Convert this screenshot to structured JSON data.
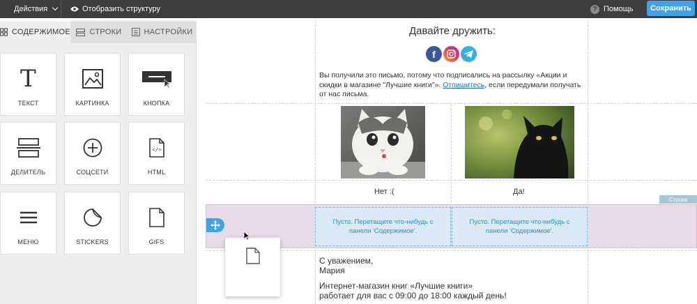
{
  "topbar": {
    "actions_label": "Действия",
    "structure_label": "Отобразить структуру",
    "help_label": "Помощь",
    "save_label": "Сохранить"
  },
  "sidebar": {
    "tabs": [
      {
        "label": "СОДЕРЖИМОЕ",
        "icon": "grid-icon",
        "active": true
      },
      {
        "label": "СТРОКИ",
        "icon": "rows-icon",
        "active": false
      },
      {
        "label": "НАСТРОЙКИ",
        "icon": "settings-panel-icon",
        "active": false
      }
    ],
    "blocks": [
      {
        "label": "ТЕКСТ",
        "icon": "text-icon"
      },
      {
        "label": "КАРТИНКА",
        "icon": "image-icon"
      },
      {
        "label": "КНОПКА",
        "icon": "button-icon"
      },
      {
        "label": "ДЕЛИТЕЛЬ",
        "icon": "divider-icon"
      },
      {
        "label": "СОЦСЕТИ",
        "icon": "social-plus-icon"
      },
      {
        "label": "HTML",
        "icon": "html-file-icon"
      },
      {
        "label": "МЕНЮ",
        "icon": "menu-icon"
      },
      {
        "label": "STICKERS",
        "icon": "sticker-icon"
      },
      {
        "label": "GIFS",
        "icon": "gif-file-icon"
      }
    ]
  },
  "canvas": {
    "friends_title": "Давайте дружить:",
    "social_icons": [
      "facebook-icon",
      "instagram-icon",
      "telegram-icon"
    ],
    "notice_before_link": "Вы получили это письмо, потому что подписались на рассылку «Акции и скидки в магазине \"Лучшие книги\"». ",
    "notice_link": "Отпишитесь",
    "notice_after_link": ", если передумали получать от нас письма.",
    "photo_left_alt": "белый котёнок",
    "photo_right_alt": "чёрный кот",
    "caption_left": "Нет :(",
    "caption_right": "Да!",
    "row_badge": "Строка",
    "empty_cell_text": "Пусто. Перетащите что-нибудь с панели 'Содержимое'.",
    "sign_line1": "С уважением,",
    "sign_line2": "Мария",
    "shop_line1": "Интернет-магазин книг «Лучшие книги»",
    "shop_line2": "работает для вас с 09:00 до 18:00 каждый день!"
  },
  "colors": {
    "topbar_bg": "#3d3d3d",
    "accent": "#3ea3e8",
    "selected_row": "#e6dbe6",
    "empty_cell": "#dbe9f6"
  }
}
